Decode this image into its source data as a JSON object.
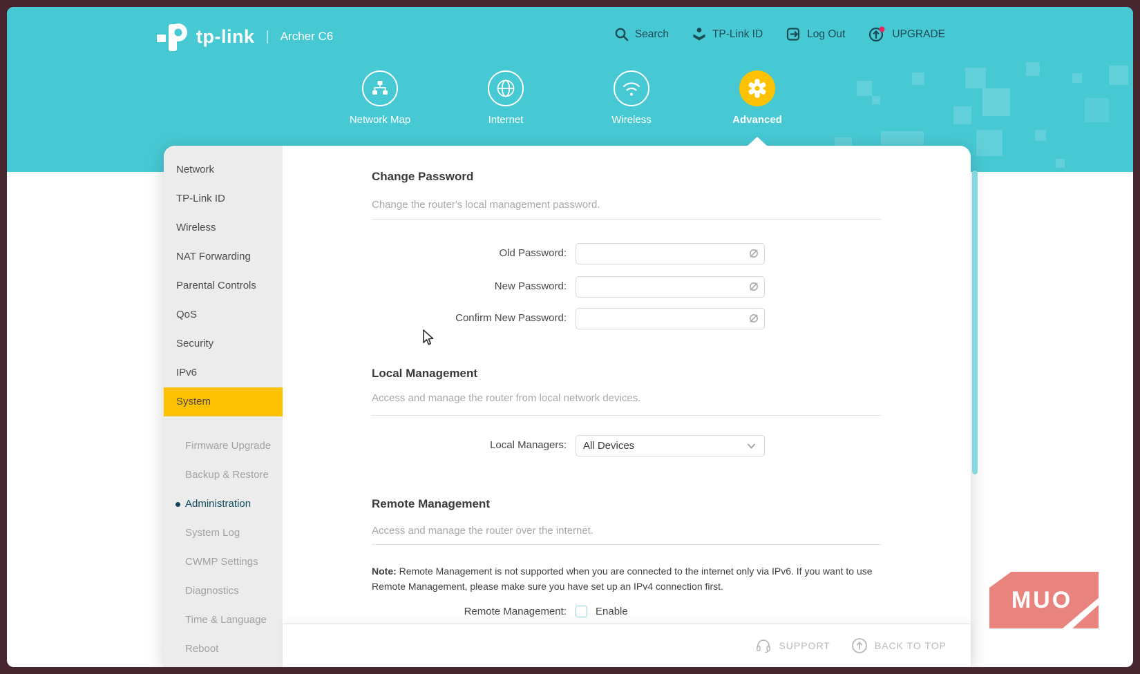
{
  "header": {
    "brand": "tp-link",
    "model": "Archer C6",
    "menu": [
      {
        "label": "Search"
      },
      {
        "label": "TP-Link ID"
      },
      {
        "label": "Log Out"
      },
      {
        "label": "UPGRADE",
        "badge": true
      }
    ],
    "tabs": [
      {
        "label": "Network Map",
        "active": false
      },
      {
        "label": "Internet",
        "active": false
      },
      {
        "label": "Wireless",
        "active": false
      },
      {
        "label": "Advanced",
        "active": true
      }
    ]
  },
  "sidebar": {
    "items": [
      "Network",
      "TP-Link ID",
      "Wireless",
      "NAT Forwarding",
      "Parental Controls",
      "QoS",
      "Security",
      "IPv6",
      "System"
    ],
    "active_item": "System",
    "subitems": [
      "Firmware Upgrade",
      "Backup & Restore",
      "Administration",
      "System Log",
      "CWMP Settings",
      "Diagnostics",
      "Time & Language",
      "Reboot"
    ],
    "active_subitem": "Administration"
  },
  "sections": {
    "change_password": {
      "title": "Change Password",
      "description": "Change the router's local management password.",
      "fields": [
        {
          "label": "Old Password:",
          "value": ""
        },
        {
          "label": "New Password:",
          "value": ""
        },
        {
          "label": "Confirm New Password:",
          "value": ""
        }
      ]
    },
    "local_management": {
      "title": "Local Management",
      "description": "Access and manage the router from local network devices.",
      "field_label": "Local Managers:",
      "selected_value": "All Devices"
    },
    "remote_management": {
      "title": "Remote Management",
      "description": "Access and manage the router over the internet.",
      "note_label": "Note:",
      "note_text": " Remote Management is not supported when you are connected to the internet only via IPv6. If you want to use Remote Management, please make sure you have set up an IPv4 connection first.",
      "field_label": "Remote Management:",
      "checkbox_label": "Enable",
      "checkbox_checked": false
    }
  },
  "footer": {
    "support": "SUPPORT",
    "back_to_top": "BACK TO TOP"
  },
  "watermark": "MUO",
  "colors": {
    "header_teal": "#47c9d4",
    "accent_yellow": "#fdc104",
    "active_link": "#0c4a5c",
    "frame": "#482630",
    "watermark_bg": "#e8837e",
    "upgrade_badge": "#e8275b"
  }
}
